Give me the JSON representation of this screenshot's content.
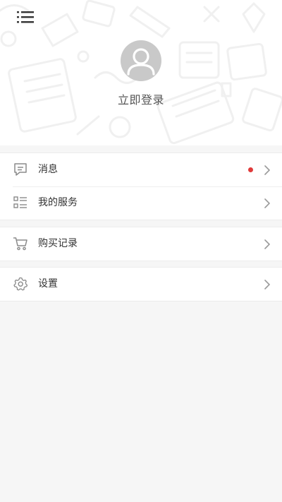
{
  "header": {
    "menu_icon": "list-menu-icon",
    "avatar_icon": "default-user-avatar-icon",
    "login_label": "立即登录"
  },
  "menu_groups": [
    {
      "items": [
        {
          "label": "消息",
          "icon": "message-bubble-icon",
          "has_unread_dot": true,
          "dot_color": "#e03a3a"
        },
        {
          "label": "我的服务",
          "icon": "service-list-icon",
          "has_unread_dot": false
        }
      ]
    },
    {
      "items": [
        {
          "label": "购买记录",
          "icon": "shopping-cart-icon",
          "has_unread_dot": false
        }
      ]
    },
    {
      "items": [
        {
          "label": "设置",
          "icon": "gear-icon",
          "has_unread_dot": false
        }
      ]
    }
  ],
  "colors": {
    "background": "#f6f6f6",
    "card": "#ffffff",
    "text": "#333333",
    "icon": "#8a8a8a",
    "accent_dot": "#e03a3a"
  }
}
